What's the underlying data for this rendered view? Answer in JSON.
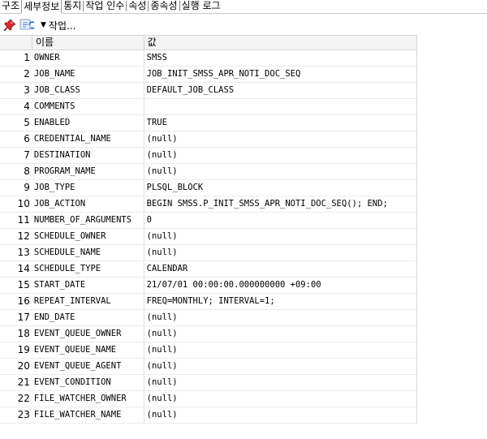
{
  "tabs": [
    {
      "label": "구조",
      "active": false
    },
    {
      "label": "세부정보",
      "active": true
    },
    {
      "label": "통지",
      "active": false
    },
    {
      "label": "작업 인수",
      "active": false
    },
    {
      "label": "속성",
      "active": false
    },
    {
      "label": "종속성",
      "active": false
    },
    {
      "label": "실행 로그",
      "active": false
    }
  ],
  "toolbar": {
    "pin_icon": "pin-icon",
    "refresh_icon": "refresh-icon",
    "actions_label": "작업..."
  },
  "grid": {
    "headers": {
      "index": "",
      "name": "이름",
      "value": "값"
    },
    "rows": [
      {
        "n": "1",
        "name": "OWNER",
        "value": "SMSS"
      },
      {
        "n": "2",
        "name": "JOB_NAME",
        "value": "JOB_INIT_SMSS_APR_NOTI_DOC_SEQ"
      },
      {
        "n": "3",
        "name": "JOB_CLASS",
        "value": "DEFAULT_JOB_CLASS"
      },
      {
        "n": "4",
        "name": "COMMENTS",
        "value": ""
      },
      {
        "n": "5",
        "name": "ENABLED",
        "value": "TRUE"
      },
      {
        "n": "6",
        "name": "CREDENTIAL_NAME",
        "value": "(null)"
      },
      {
        "n": "7",
        "name": "DESTINATION",
        "value": "(null)"
      },
      {
        "n": "8",
        "name": "PROGRAM_NAME",
        "value": "(null)"
      },
      {
        "n": "9",
        "name": "JOB_TYPE",
        "value": "PLSQL_BLOCK"
      },
      {
        "n": "10",
        "name": "JOB_ACTION",
        "value": "BEGIN SMSS.P_INIT_SMSS_APR_NOTI_DOC_SEQ(); END;"
      },
      {
        "n": "11",
        "name": "NUMBER_OF_ARGUMENTS",
        "value": "0"
      },
      {
        "n": "12",
        "name": "SCHEDULE_OWNER",
        "value": "(null)"
      },
      {
        "n": "13",
        "name": "SCHEDULE_NAME",
        "value": "(null)"
      },
      {
        "n": "14",
        "name": "SCHEDULE_TYPE",
        "value": "CALENDAR"
      },
      {
        "n": "15",
        "name": "START_DATE",
        "value": "21/07/01 00:00:00.000000000 +09:00"
      },
      {
        "n": "16",
        "name": "REPEAT_INTERVAL",
        "value": "FREQ=MONTHLY; INTERVAL=1;"
      },
      {
        "n": "17",
        "name": "END_DATE",
        "value": "(null)"
      },
      {
        "n": "18",
        "name": "EVENT_QUEUE_OWNER",
        "value": "(null)"
      },
      {
        "n": "19",
        "name": "EVENT_QUEUE_NAME",
        "value": "(null)"
      },
      {
        "n": "20",
        "name": "EVENT_QUEUE_AGENT",
        "value": "(null)"
      },
      {
        "n": "21",
        "name": "EVENT_CONDITION",
        "value": "(null)"
      },
      {
        "n": "22",
        "name": "FILE_WATCHER_OWNER",
        "value": "(null)"
      },
      {
        "n": "23",
        "name": "FILE_WATCHER_NAME",
        "value": "(null)"
      }
    ]
  }
}
